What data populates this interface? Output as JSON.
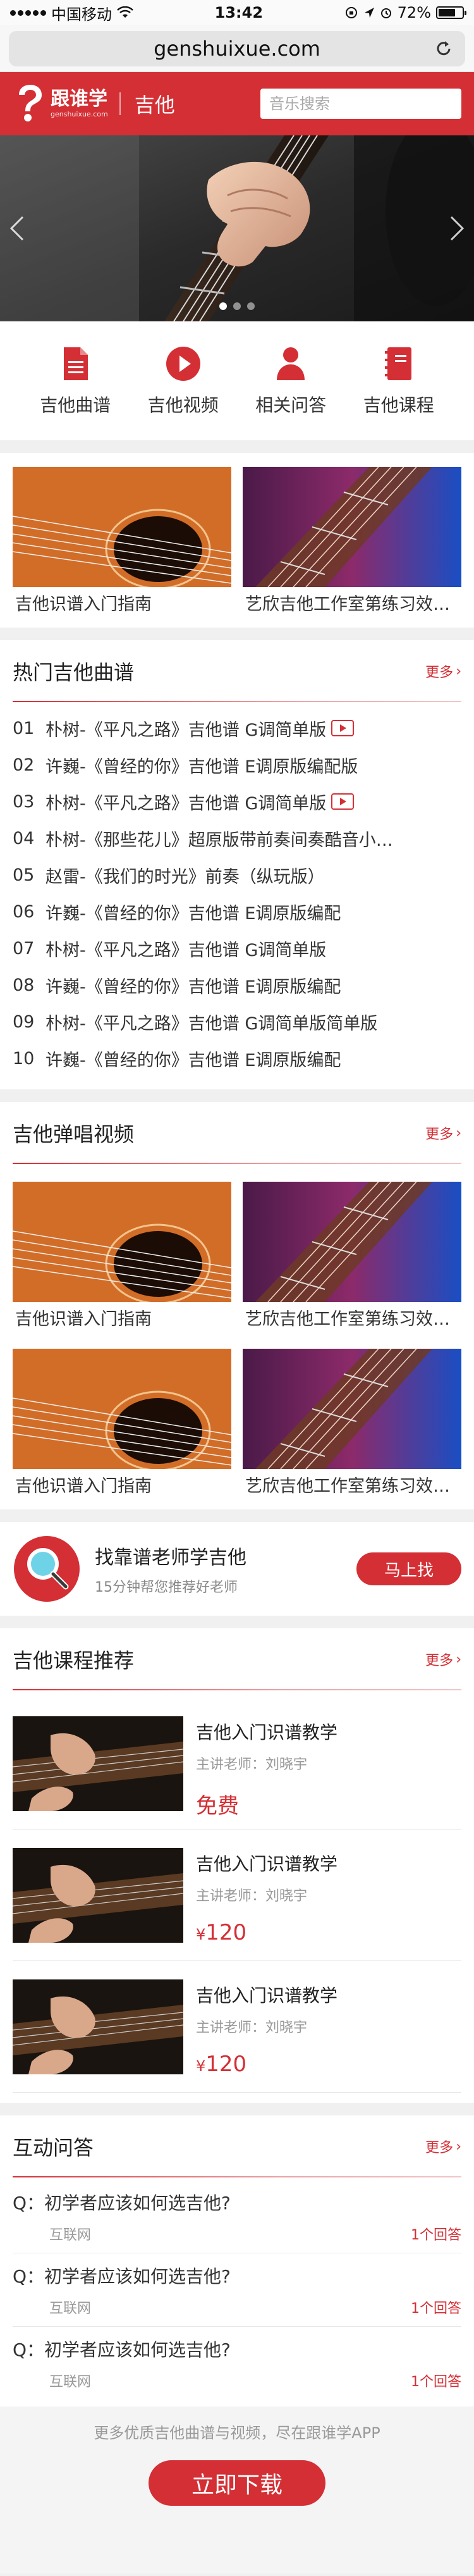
{
  "status_bar": {
    "carrier": "中国移动",
    "time": "13:42",
    "battery_percent": "72%",
    "battery_level": 0.72
  },
  "browser": {
    "url": "genshuixue.com"
  },
  "header": {
    "logo_cn": "跟谁学",
    "logo_en": "genshuixue.com",
    "title": "吉他",
    "search_placeholder": "音乐搜索"
  },
  "banner": {
    "slide_count": 3,
    "active_slide": 1
  },
  "quick_nav": [
    {
      "label": "吉他曲谱",
      "icon": "sheet-music-icon"
    },
    {
      "label": "吉他视频",
      "icon": "play-video-icon"
    },
    {
      "label": "相关问答",
      "icon": "user-qa-icon"
    },
    {
      "label": "吉他课程",
      "icon": "course-book-icon"
    }
  ],
  "featured": [
    {
      "title": "吉他识谱入门指南",
      "image": "acoustic-guitar-image"
    },
    {
      "title": "艺欣吉他工作室第练习效果…",
      "image": "guitar-strings-image"
    }
  ],
  "hot_songs": {
    "title": "热门吉他曲谱",
    "more": "更多",
    "items": [
      {
        "num": "01",
        "title": "朴树-《平凡之路》吉他谱 G调简单版",
        "video": true
      },
      {
        "num": "02",
        "title": "许巍-《曾经的你》吉他谱 E调原版编配版",
        "video": false
      },
      {
        "num": "03",
        "title": "朴树-《平凡之路》吉他谱 G调简单版",
        "video": true
      },
      {
        "num": "04",
        "title": "朴树-《那些花儿》超原版带前奏间奏酷音小…",
        "video": false
      },
      {
        "num": "05",
        "title": "赵雷-《我们的时光》前奏（纵玩版）",
        "video": false
      },
      {
        "num": "06",
        "title": "许巍-《曾经的你》吉他谱 E调原版编配",
        "video": false
      },
      {
        "num": "07",
        "title": "朴树-《平凡之路》吉他谱 G调简单版",
        "video": false
      },
      {
        "num": "08",
        "title": "许巍-《曾经的你》吉他谱 E调原版编配",
        "video": false
      },
      {
        "num": "09",
        "title": "朴树-《平凡之路》吉他谱 G调简单版简单版",
        "video": false
      },
      {
        "num": "10",
        "title": "许巍-《曾经的你》吉他谱 E调原版编配",
        "video": false
      }
    ]
  },
  "videos": {
    "title": "吉他弹唱视频",
    "more": "更多",
    "items": [
      {
        "title": "吉他识谱入门指南",
        "image": "acoustic-guitar-image"
      },
      {
        "title": "艺欣吉他工作室第练习效果…",
        "image": "guitar-strings-image"
      },
      {
        "title": "吉他识谱入门指南",
        "image": "acoustic-guitar-image"
      },
      {
        "title": "艺欣吉他工作室第练习效果…",
        "image": "guitar-strings-image"
      }
    ]
  },
  "teacher": {
    "title": "找靠谱老师学吉他",
    "subtitle": "15分钟帮您推荐好老师",
    "button": "马上找",
    "icon": "search-teacher-icon"
  },
  "courses": {
    "title": "吉他课程推荐",
    "more": "更多",
    "items": [
      {
        "title": "吉他入门识谱教学",
        "teacher": "主讲老师：刘晓宇",
        "price": "免费",
        "currency": ""
      },
      {
        "title": "吉他入门识谱教学",
        "teacher": "主讲老师：刘晓宇",
        "price": "120",
        "currency": "¥"
      },
      {
        "title": "吉他入门识谱教学",
        "teacher": "主讲老师：刘晓宇",
        "price": "120",
        "currency": "¥"
      }
    ]
  },
  "qa": {
    "title": "互动问答",
    "more": "更多",
    "items": [
      {
        "question": "Q：初学者应该如何选吉他?",
        "source": "互联网",
        "answers": "1个回答"
      },
      {
        "question": "Q：初学者应该如何选吉他?",
        "source": "互联网",
        "answers": "1个回答"
      },
      {
        "question": "Q：初学者应该如何选吉他?",
        "source": "互联网",
        "answers": "1个回答"
      }
    ]
  },
  "footer": {
    "text": "更多优质吉他曲谱与视频，尽在跟谁学APP",
    "button": "立即下载"
  },
  "colors": {
    "brand_red": "#d32f35",
    "text": "#333333",
    "muted": "#999999"
  }
}
